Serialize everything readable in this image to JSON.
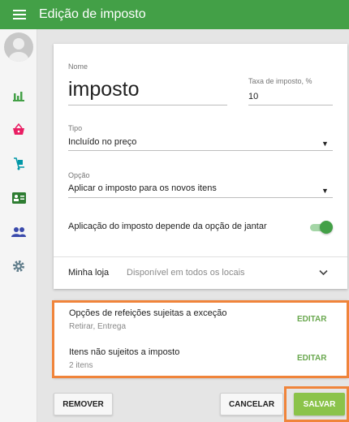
{
  "app": {
    "title": "Edição de imposto",
    "accent": "#43a047",
    "highlight": "#f0843a"
  },
  "sidebar": {
    "items": [
      {
        "icon": "bar-chart-icon",
        "color": "#43a047"
      },
      {
        "icon": "basket-icon",
        "color": "#e91e63"
      },
      {
        "icon": "hand-truck-icon",
        "color": "#0097a7"
      },
      {
        "icon": "id-card-icon",
        "color": "#2e7d32"
      },
      {
        "icon": "people-icon",
        "color": "#3949ab"
      },
      {
        "icon": "gear-icon",
        "color": "#607d8b"
      }
    ]
  },
  "form": {
    "name_label": "Nome",
    "name_value": "imposto",
    "rate_label": "Taxa de imposto, %",
    "rate_value": "10",
    "type_label": "Tipo",
    "type_value": "Incluído no preço",
    "option_label": "Opção",
    "option_value": "Aplicar o imposto para os novos itens",
    "dining_toggle_label": "Aplicação do imposto depende da opção de jantar",
    "dining_toggle_on": true,
    "store_label": "Minha loja",
    "store_value": "Disponível em todos os locais"
  },
  "exceptions": {
    "dining_title": "Opções de refeições sujeitas a exceção",
    "dining_sub": "Retirar, Entrega",
    "dining_edit": "EDITAR",
    "items_title": "Itens não sujeitos a imposto",
    "items_sub": "2 itens",
    "items_edit": "EDITAR"
  },
  "actions": {
    "remove": "REMOVER",
    "cancel": "CANCELAR",
    "save": "SALVAR"
  }
}
